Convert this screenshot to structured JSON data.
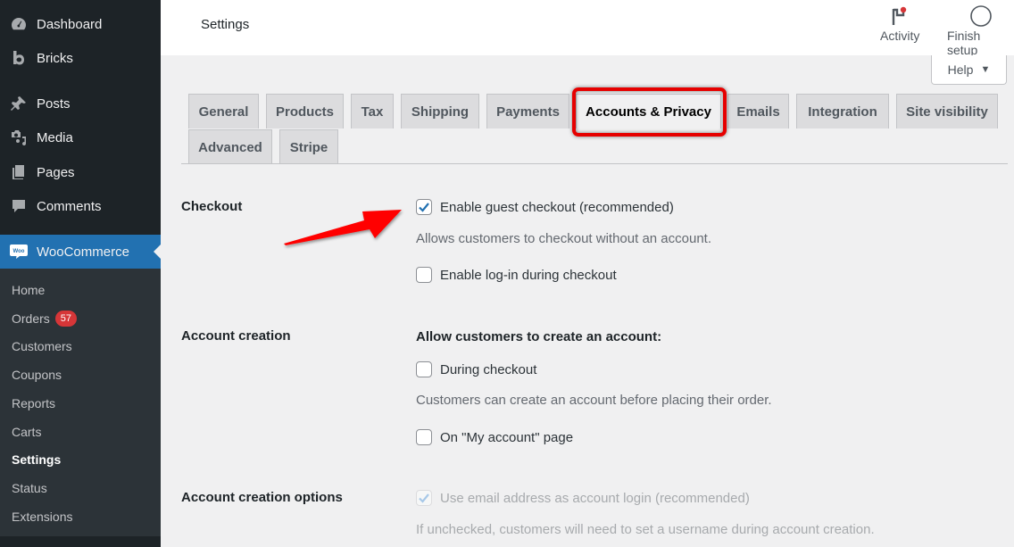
{
  "sidebar": {
    "items": [
      {
        "label": "Dashboard",
        "icon": "dashboard-icon"
      },
      {
        "label": "Bricks",
        "icon": "bricks-icon"
      },
      {
        "label": "Posts",
        "icon": "pin-icon"
      },
      {
        "label": "Media",
        "icon": "media-icon"
      },
      {
        "label": "Pages",
        "icon": "pages-icon"
      },
      {
        "label": "Comments",
        "icon": "comment-icon"
      }
    ],
    "woocommerce": {
      "label": "WooCommerce",
      "icon": "woo-icon",
      "logo_text": "Woo"
    },
    "submenu": [
      {
        "label": "Home"
      },
      {
        "label": "Orders",
        "badge": "57"
      },
      {
        "label": "Customers"
      },
      {
        "label": "Coupons"
      },
      {
        "label": "Reports"
      },
      {
        "label": "Carts"
      },
      {
        "label": "Settings",
        "current": true
      },
      {
        "label": "Status"
      },
      {
        "label": "Extensions"
      }
    ]
  },
  "header": {
    "title": "Settings",
    "activity_label": "Activity",
    "finish_setup_label": "Finish setup",
    "help_label": "Help",
    "help_arrow": "▼"
  },
  "tabs": [
    {
      "label": "General"
    },
    {
      "label": "Products"
    },
    {
      "label": "Tax"
    },
    {
      "label": "Shipping"
    },
    {
      "label": "Payments"
    },
    {
      "label": "Accounts & Privacy",
      "active": true
    },
    {
      "label": "Emails"
    },
    {
      "label": "Integration"
    },
    {
      "label": "Site visibility"
    },
    {
      "label": "Advanced"
    },
    {
      "label": "Stripe"
    }
  ],
  "form": {
    "checkout": {
      "label": "Checkout",
      "guest_checkout": {
        "label": "Enable guest checkout (recommended)",
        "checked": true
      },
      "guest_desc": "Allows customers to checkout without an account.",
      "login_checkout": {
        "label": "Enable log-in during checkout",
        "checked": false
      }
    },
    "account_creation": {
      "label": "Account creation",
      "heading": "Allow customers to create an account:",
      "during_checkout": {
        "label": "During checkout",
        "checked": false
      },
      "during_desc": "Customers can create an account before placing their order.",
      "my_account": {
        "label": "On \"My account\" page",
        "checked": false
      }
    },
    "account_options": {
      "label": "Account creation options",
      "email_login": {
        "label": "Use email address as account login (recommended)",
        "checked": true,
        "disabled": true
      },
      "email_desc": "If unchecked, customers will need to set a username during account creation."
    }
  },
  "colors": {
    "accent": "#2271b1",
    "highlight": "#e60000",
    "badge": "#d63638"
  }
}
